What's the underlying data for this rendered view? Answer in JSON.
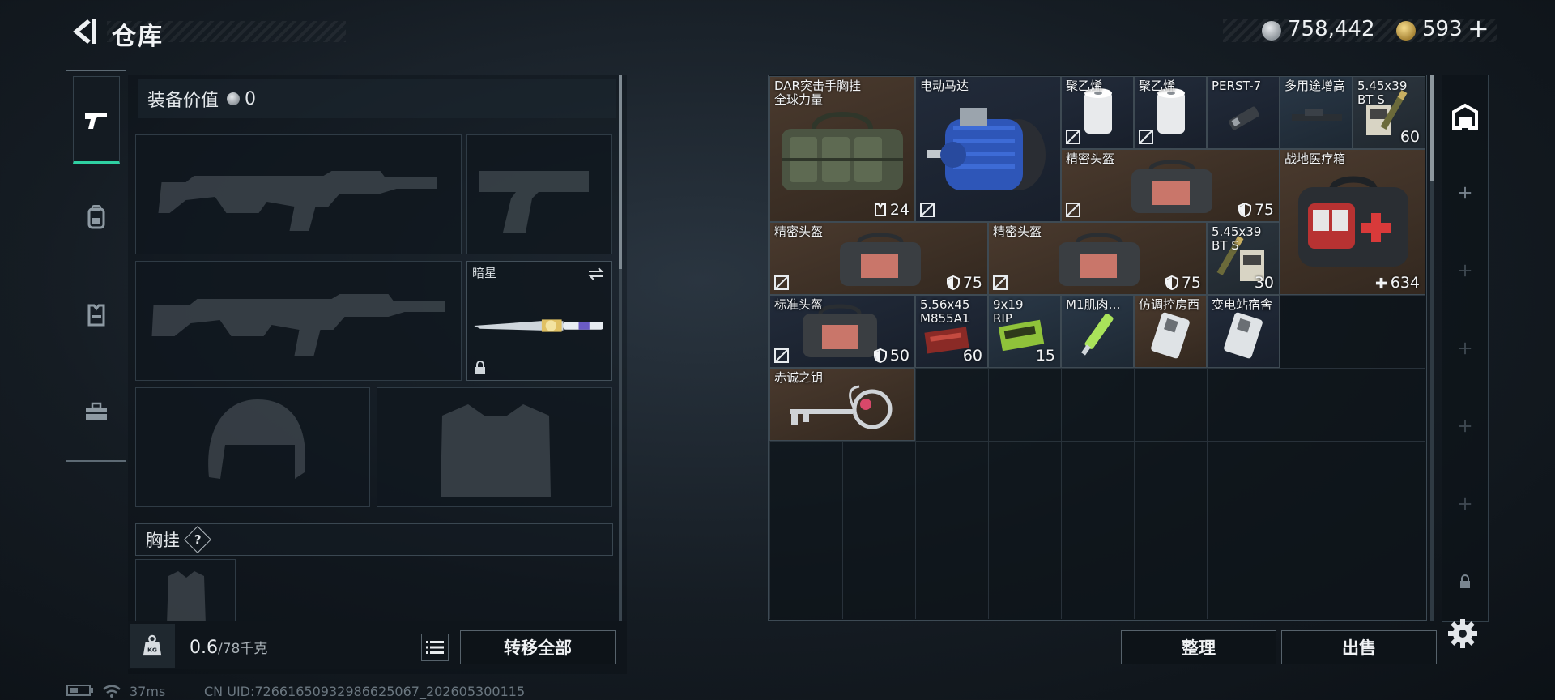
{
  "header": {
    "title": "仓库"
  },
  "currency": {
    "silver": "758,442",
    "gold": "593",
    "add_label": "+"
  },
  "equipment": {
    "value_label": "装备价值",
    "value": "0",
    "melee_name": "暗星",
    "chest_rig_label": "胸挂",
    "help": "?"
  },
  "footer_left": {
    "weight_current": "0.6",
    "weight_max": "/78千克",
    "transfer_all": "转移全部"
  },
  "footer_right": {
    "sort": "整理",
    "sell": "出售"
  },
  "status": {
    "ping": "37ms",
    "uid": "CN UID:72661650932986625067_202605300115"
  },
  "warehouse": {
    "items": [
      {
        "name": "DAR突击手胸挂\n全球力量",
        "count": "24",
        "badge": "rig",
        "bg": "brown"
      },
      {
        "name": "电动马达",
        "count": "",
        "bg": "navy"
      },
      {
        "name": "聚乙烯",
        "count": "",
        "bg": "navy"
      },
      {
        "name": "聚乙烯",
        "count": "",
        "bg": "navy"
      },
      {
        "name": "PERST-7",
        "count": "",
        "bg": "navy"
      },
      {
        "name": "多用途增高",
        "count": "",
        "bg": "blue"
      },
      {
        "name": "5.45x39\nBT S",
        "count": "60",
        "bg": "gray"
      },
      {
        "name": "精密头盔",
        "count": "75",
        "badge": "shield",
        "bg": "brown"
      },
      {
        "name": "战地医疗箱",
        "count": "634",
        "badge": "plus",
        "bg": "brown"
      },
      {
        "name": "精密头盔",
        "count": "75",
        "badge": "shield",
        "bg": "brown"
      },
      {
        "name": "精密头盔",
        "count": "75",
        "badge": "shield",
        "bg": "brown"
      },
      {
        "name": "5.45x39\nBT S",
        "count": "30",
        "bg": "gray"
      },
      {
        "name": "标准头盔",
        "count": "50",
        "badge": "shield",
        "bg": "navy"
      },
      {
        "name": "5.56x45\nM855A1",
        "count": "60",
        "bg": "navy"
      },
      {
        "name": "9x19\nRIP",
        "count": "15",
        "bg": "blue"
      },
      {
        "name": "M1肌肉…",
        "count": "",
        "bg": "blue"
      },
      {
        "name": "仿调控房西",
        "count": "",
        "bg": "brown"
      },
      {
        "name": "变电站宿舍",
        "count": "",
        "bg": "navy"
      },
      {
        "name": "赤诚之钥",
        "count": "",
        "bg": "brown"
      }
    ]
  }
}
